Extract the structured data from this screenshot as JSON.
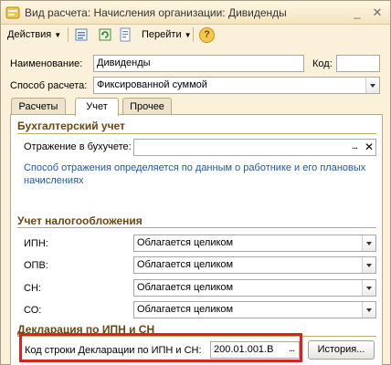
{
  "window": {
    "title": "Вид расчета: Начисления организации: Дивиденды"
  },
  "toolbar": {
    "actions_label": "Действия",
    "goto_label": "Перейти",
    "help_symbol": "?"
  },
  "header": {
    "name_label": "Наименование:",
    "name_value": "Дивиденды",
    "code_label": "Код:",
    "code_value": "",
    "method_label": "Способ расчета:",
    "method_value": "Фиксированной суммой"
  },
  "tabs": [
    {
      "label": "Расчеты",
      "active": false
    },
    {
      "label": "Учет",
      "active": true
    },
    {
      "label": "Прочее",
      "active": false
    }
  ],
  "accounting": {
    "title": "Бухгалтерский учет",
    "reflection_label": "Отражение в бухучете:",
    "reflection_value": "",
    "hint": "Способ отражения определяется по данным о работнике и его плановых начислениях"
  },
  "tax": {
    "title": "Учет налогообложения",
    "rows": [
      {
        "label": "ИПН:",
        "value": "Облагается целиком"
      },
      {
        "label": "ОПВ:",
        "value": "Облагается целиком"
      },
      {
        "label": "СН:",
        "value": "Облагается целиком"
      },
      {
        "label": "СО:",
        "value": "Облагается целиком"
      }
    ]
  },
  "declaration": {
    "title": "Декларация по ИПН и СН",
    "code_label": "Код строки Декларации по ИПН и СН:",
    "code_value": "200.01.001.В",
    "history_label": "История..."
  },
  "colors": {
    "window_bg": "#fbf0d9",
    "section_title": "#6a4713",
    "hint_text": "#1f57b5",
    "highlight": "#e02020"
  },
  "icons": [
    "app-icon",
    "minimize-icon",
    "close-icon",
    "list-icon",
    "refresh-icon",
    "document-icon",
    "goto-icon",
    "help-icon",
    "dropdown-icon",
    "clear-icon"
  ]
}
